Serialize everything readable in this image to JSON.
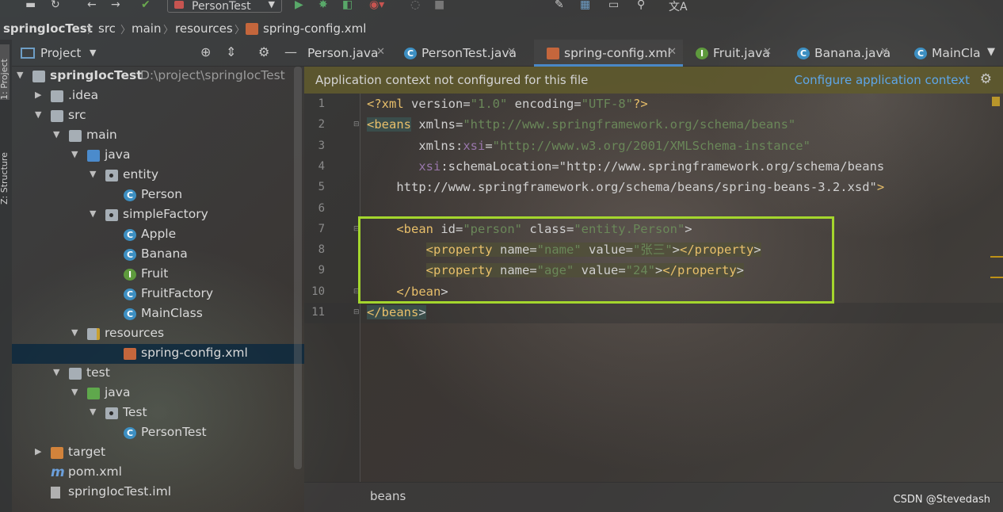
{
  "toolbar": {
    "run_config": "PersonTest"
  },
  "breadcrumb": [
    "springIocTest",
    "src",
    "main",
    "resources",
    "spring-config.xml"
  ],
  "left_strip": {
    "project_tab": "1: Project",
    "structure_tab": "Z: Structure"
  },
  "project_panel": {
    "title": "Project"
  },
  "tree": [
    {
      "label": "springIocTest",
      "path": "D:\\project\\springIocTest",
      "icon": "module-folder-icon",
      "indent": 0,
      "arrow": "down",
      "bold": true
    },
    {
      "label": ".idea",
      "icon": "folder-icon",
      "indent": 1,
      "arrow": "right"
    },
    {
      "label": "src",
      "icon": "folder-icon",
      "indent": 1,
      "arrow": "down"
    },
    {
      "label": "main",
      "icon": "folder-icon",
      "indent": 2,
      "arrow": "down"
    },
    {
      "label": "java",
      "icon": "source-folder-icon",
      "indent": 3,
      "arrow": "down"
    },
    {
      "label": "entity",
      "icon": "package-icon",
      "indent": 4,
      "arrow": "down"
    },
    {
      "label": "Person",
      "icon": "class-icon",
      "indent": 5
    },
    {
      "label": "simpleFactory",
      "icon": "package-icon",
      "indent": 4,
      "arrow": "down"
    },
    {
      "label": "Apple",
      "icon": "class-icon",
      "indent": 5
    },
    {
      "label": "Banana",
      "icon": "class-icon",
      "indent": 5
    },
    {
      "label": "Fruit",
      "icon": "interface-icon",
      "indent": 5
    },
    {
      "label": "FruitFactory",
      "icon": "class-icon",
      "indent": 5
    },
    {
      "label": "MainClass",
      "icon": "class-icon",
      "indent": 5
    },
    {
      "label": "resources",
      "icon": "resources-folder-icon",
      "indent": 3,
      "arrow": "down"
    },
    {
      "label": "spring-config.xml",
      "icon": "spring-xml-icon",
      "indent": 5,
      "selected": true
    },
    {
      "label": "test",
      "icon": "folder-icon",
      "indent": 2,
      "arrow": "down"
    },
    {
      "label": "java",
      "icon": "test-folder-icon",
      "indent": 3,
      "arrow": "down"
    },
    {
      "label": "Test",
      "icon": "package-icon",
      "indent": 4,
      "arrow": "down"
    },
    {
      "label": "PersonTest",
      "icon": "class-icon",
      "indent": 5
    },
    {
      "label": "target",
      "icon": "excluded-folder-icon",
      "indent": 1,
      "arrow": "right"
    },
    {
      "label": "pom.xml",
      "icon": "maven-icon",
      "indent": 1
    },
    {
      "label": "springIocTest.iml",
      "icon": "iml-file-icon",
      "indent": 1
    }
  ],
  "tabs": [
    {
      "label": "Person.java",
      "icon": "none"
    },
    {
      "label": "PersonTest.java",
      "icon": "class-icon"
    },
    {
      "label": "spring-config.xml",
      "icon": "spring-xml-icon",
      "active": true
    },
    {
      "label": "Fruit.java",
      "icon": "interface-icon"
    },
    {
      "label": "Banana.java",
      "icon": "class-icon"
    },
    {
      "label": "MainCla",
      "icon": "class-icon"
    }
  ],
  "banner": {
    "message": "Application context not configured for this file",
    "link": "Configure application context"
  },
  "line_numbers": [
    "1",
    "2",
    "3",
    "4",
    "5",
    "6",
    "7",
    "8",
    "9",
    "10",
    "11"
  ],
  "code_lines": [
    "<?xml version=\"1.0\" encoding=\"UTF-8\"?>",
    "<beans xmlns=\"http://www.springframework.org/schema/beans\"",
    "       xmlns:xsi=\"http://www.w3.org/2001/XMLSchema-instance\"",
    "       xsi:schemaLocation=\"http://www.springframework.org/schema/beans",
    "    http://www.springframework.org/schema/beans/spring-beans-3.2.xsd\">",
    "",
    "    <bean id=\"person\" class=\"entity.Person\">",
    "        <property name=\"name\" value=\"张三\"></property>",
    "        <property name=\"age\" value=\"24\"></property>",
    "    </bean>",
    "</beans>"
  ],
  "status_breadcrumb": "beans",
  "watermark": "CSDN @Stevedash",
  "colors": {
    "selection": "#0d293e",
    "annotation_box": "#a4d62d",
    "link": "#5ea6e8",
    "xml_tag": "#e8bf6a",
    "xml_value": "#6a8759",
    "xml_namespace": "#9876aa"
  }
}
